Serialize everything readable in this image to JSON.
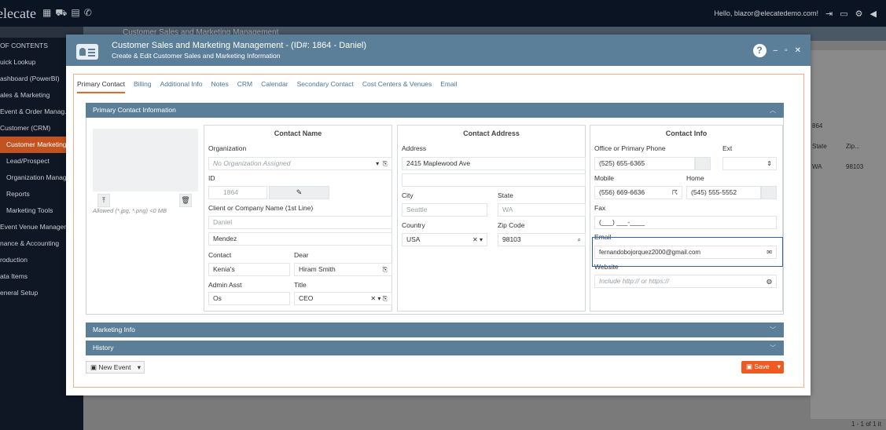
{
  "topbar": {
    "brand": "elecate",
    "greeting": "Hello, blazor@elecatedemo.com!"
  },
  "sidebar": {
    "items": [
      {
        "label": "OF CONTENTS"
      },
      {
        "label": "uick Lookup"
      },
      {
        "label": "ashboard (PowerBI)"
      },
      {
        "label": "ales & Marketing"
      },
      {
        "label": "Event & Order Manag..."
      },
      {
        "label": "Customer (CRM)"
      },
      {
        "label": "Customer Marketing"
      },
      {
        "label": "Lead/Prospect"
      },
      {
        "label": "Organization Manag"
      },
      {
        "label": "Reports"
      },
      {
        "label": "Marketing Tools"
      },
      {
        "label": "Event Venue Managem"
      },
      {
        "label": "nance & Accounting"
      },
      {
        "label": "roduction"
      },
      {
        "label": "ata Items"
      },
      {
        "label": "eneral Setup"
      }
    ]
  },
  "background": {
    "title": "Customer Sales and Marketing Management",
    "filter_value": "864",
    "col_state": "State",
    "col_zip": "Zip...",
    "row_state": "WA",
    "row_zip": "98103",
    "pager": "1 - 1 of 1 it"
  },
  "modal": {
    "title": "Customer Sales and Marketing Management - (ID#: 1864 - Daniel)",
    "subtitle": "Create & Edit Customer Sales and Marketing Information",
    "tabs": [
      "Primary Contact",
      "Billing",
      "Additional Info",
      "Notes",
      "CRM",
      "Calendar",
      "Secondary Contact",
      "Cost Centers & Venues",
      "Email"
    ],
    "section_title": "Primary Contact Information",
    "photo_note": "Allowed (*.jpg, *.png) <0 MB",
    "contact_name": {
      "title": "Contact Name",
      "org_label": "Organization",
      "org_placeholder": "No Organization Assigned",
      "id_label": "ID",
      "id_value": "1864",
      "client_label": "Client or Company Name (1st Line)",
      "client_value": "Daniel",
      "last_name_value": "Mendez",
      "contact_label": "Contact",
      "contact_value": "Kenia's",
      "dear_label": "Dear",
      "dear_value": "Hiram Smith",
      "admin_label": "Admin Asst",
      "admin_value": "Os",
      "title_label": "Title",
      "title_value": "CEO"
    },
    "contact_address": {
      "title": "Contact Address",
      "address_label": "Address",
      "address_value": "2415 Maplewood Ave",
      "city_label": "City",
      "city_value": "Seattle",
      "state_label": "State",
      "state_value": "WA",
      "country_label": "Country",
      "country_value": "USA",
      "zip_label": "Zip Code",
      "zip_value": "98103"
    },
    "contact_info": {
      "title": "Contact Info",
      "office_label": "Office or Primary Phone",
      "ext_label": "Ext",
      "office_value": "(525) 655-6365",
      "mobile_label": "Mobile",
      "home_label": "Home",
      "mobile_value": "(556) 669-6636",
      "home_value": "(545) 555-5552",
      "fax_label": "Fax",
      "fax_placeholder": "(___) ___-____",
      "email_label": "Email",
      "email_value": "fernandobojorquez2000@gmail.com",
      "website_label": "Website",
      "website_placeholder": "Include http:// or https://"
    },
    "marketing_info": "Marketing Info",
    "history": "History",
    "new_event_label": "New Event",
    "save_label": "Save"
  },
  "colors": {
    "header_blue": "#5c7f99",
    "accent_orange": "#ee5a22",
    "email_highlight": "#2e5fb0"
  }
}
